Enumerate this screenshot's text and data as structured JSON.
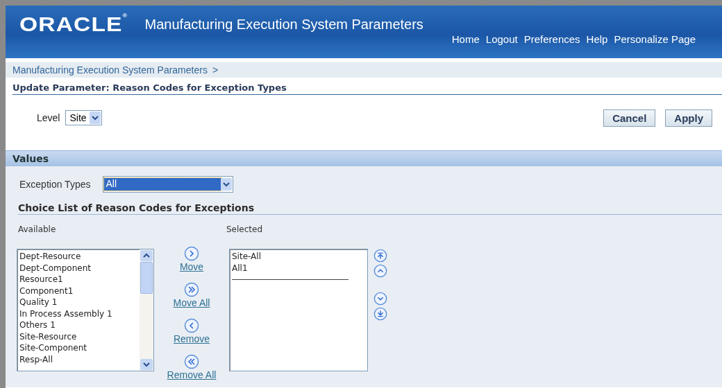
{
  "header": {
    "logo": "ORACLE",
    "logo_mark": "®",
    "title": "Manufacturing Execution System Parameters",
    "links": [
      "Home",
      "Logout",
      "Preferences",
      "Help",
      "Personalize Page"
    ]
  },
  "breadcrumb": {
    "items": [
      "Manufacturing Execution System Parameters"
    ],
    "separator": ">"
  },
  "page_title": "Update Parameter: Reason Codes for Exception Types",
  "level": {
    "label": "Level",
    "value": "Site"
  },
  "buttons": [
    "Cancel",
    "Apply"
  ],
  "values": {
    "title": "Values",
    "exception_types": {
      "label": "Exception Types",
      "value": "All",
      "focused": true
    },
    "choice_title": "Choice List of Reason Codes for Exceptions",
    "available": {
      "label": "Available",
      "items": [
        "Dept-Resource",
        "Dept-Component",
        "Resource1",
        "Component1",
        "Quality 1",
        "In Process Assembly 1",
        "Others 1",
        "Site-Resource",
        "Site-Component",
        "Resp-All"
      ]
    },
    "shuttle": [
      {
        "kind": "move",
        "label": "Move"
      },
      {
        "kind": "move_all",
        "label": "Move All"
      },
      {
        "kind": "remove",
        "label": "Remove"
      },
      {
        "kind": "remove_all",
        "label": "Remove All"
      }
    ],
    "selected": {
      "label": "Selected",
      "items": [
        "Site-All",
        "All1"
      ]
    }
  }
}
